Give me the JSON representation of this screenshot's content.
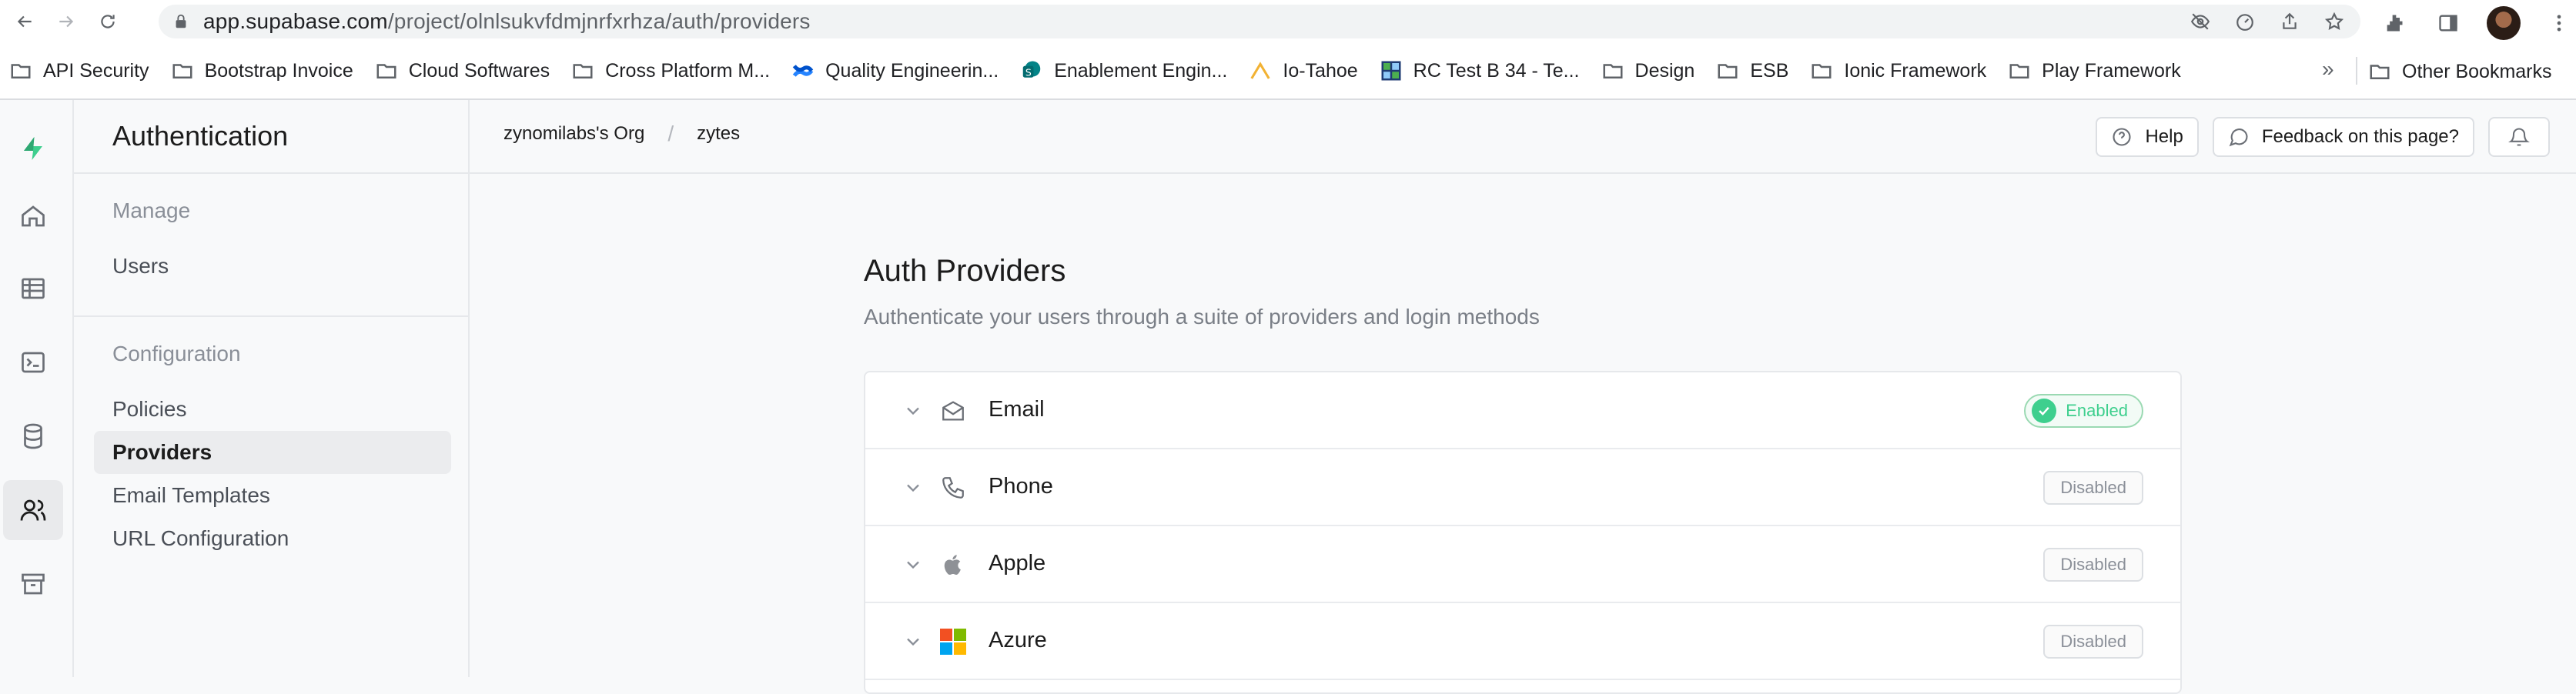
{
  "browser": {
    "url_host": "app.supabase.com",
    "url_path": "/project/olnlsukvfdmjnrfxrhza/auth/providers",
    "bookmarks": [
      "API Security",
      "Bootstrap Invoice",
      "Cloud Softwares",
      "Cross Platform M...",
      "Quality Engineerin...",
      "Enablement Engin...",
      "Io-Tahoe",
      "RC Test B 34 - Te...",
      "Design",
      "ESB",
      "Ionic Framework",
      "Play Framework"
    ],
    "more_bookmarks": "»",
    "other_bookmarks": "Other Bookmarks"
  },
  "sidebar": {
    "header": "Authentication",
    "groups": [
      {
        "title": "Manage",
        "items": [
          "Users"
        ]
      },
      {
        "title": "Configuration",
        "items": [
          "Policies",
          "Providers",
          "Email Templates",
          "URL Configuration"
        ]
      }
    ],
    "active_item": "Providers"
  },
  "topbar": {
    "org": "zynomilabs's Org",
    "separator": "/",
    "project": "zytes",
    "help_label": "Help",
    "feedback_label": "Feedback on this page?"
  },
  "main": {
    "title": "Auth Providers",
    "subtitle": "Authenticate your users through a suite of providers and login methods",
    "providers": [
      {
        "name": "Email",
        "status": "Enabled",
        "icon": "mail-icon"
      },
      {
        "name": "Phone",
        "status": "Disabled",
        "icon": "phone-icon"
      },
      {
        "name": "Apple",
        "status": "Disabled",
        "icon": "apple-icon"
      },
      {
        "name": "Azure",
        "status": "Disabled",
        "icon": "microsoft-icon"
      }
    ]
  },
  "colors": {
    "brand_green": "#3ecf8e",
    "background": "#f8f9fa",
    "border": "#e6e8eb"
  }
}
